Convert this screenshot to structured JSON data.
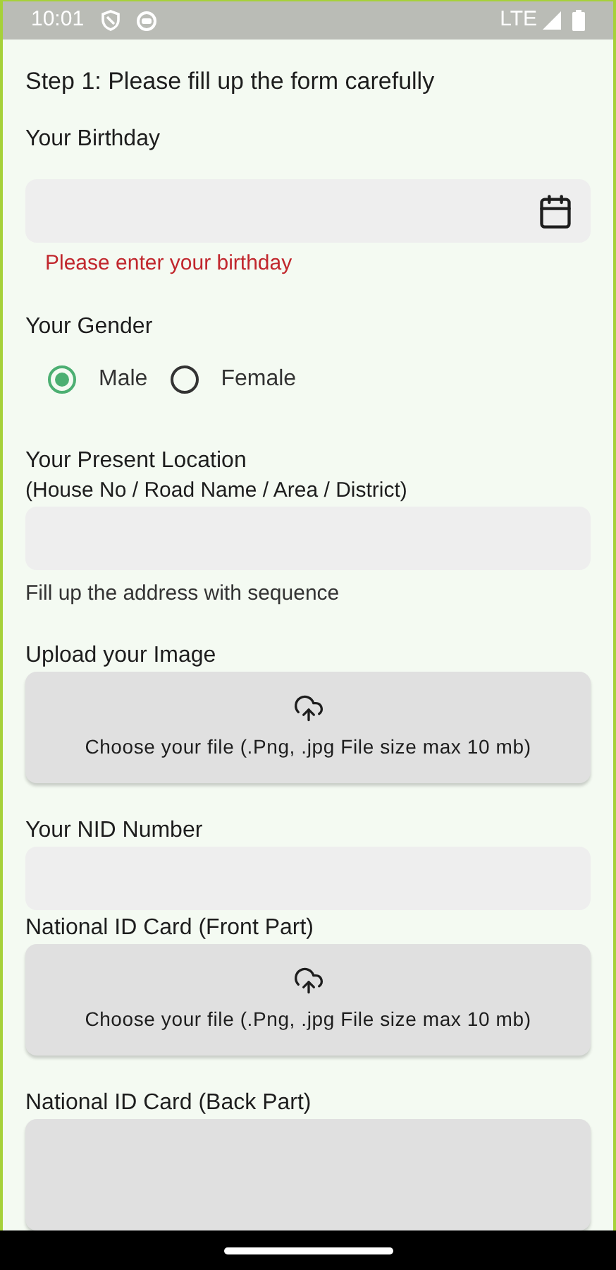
{
  "status_bar": {
    "time": "10:01",
    "network": "LTE"
  },
  "form": [
    {
      "kind": "heading",
      "text": "Step 1: Please fill up the form carefully"
    },
    {
      "kind": "label",
      "text": "Your Birthday"
    },
    {
      "kind": "date_field"
    },
    {
      "kind": "error",
      "text": "Please enter your birthday"
    },
    {
      "kind": "label",
      "text": "Your Gender"
    },
    {
      "kind": "radio_group",
      "options": [
        {
          "label": "Male",
          "selected": true
        },
        {
          "label": "Female",
          "selected": false
        }
      ]
    },
    {
      "kind": "label",
      "text": "Your Present Location"
    },
    {
      "kind": "sublabel",
      "text": "(House No / Road Name / Area / District)"
    },
    {
      "kind": "text_field"
    },
    {
      "kind": "helper",
      "text": "Fill up the address with sequence"
    },
    {
      "kind": "label",
      "text": "Upload your Image"
    },
    {
      "kind": "upload",
      "text": "Choose your file (.Png, .jpg File size max 10 mb)"
    },
    {
      "kind": "label",
      "text": "Your NID Number"
    },
    {
      "kind": "text_field"
    },
    {
      "kind": "label",
      "text": "National ID Card (Front Part)"
    },
    {
      "kind": "upload",
      "text": "Choose your file (.Png, .jpg File size max 10 mb)"
    },
    {
      "kind": "label",
      "text": "National ID Card (Back Part)"
    },
    {
      "kind": "upload"
    }
  ]
}
